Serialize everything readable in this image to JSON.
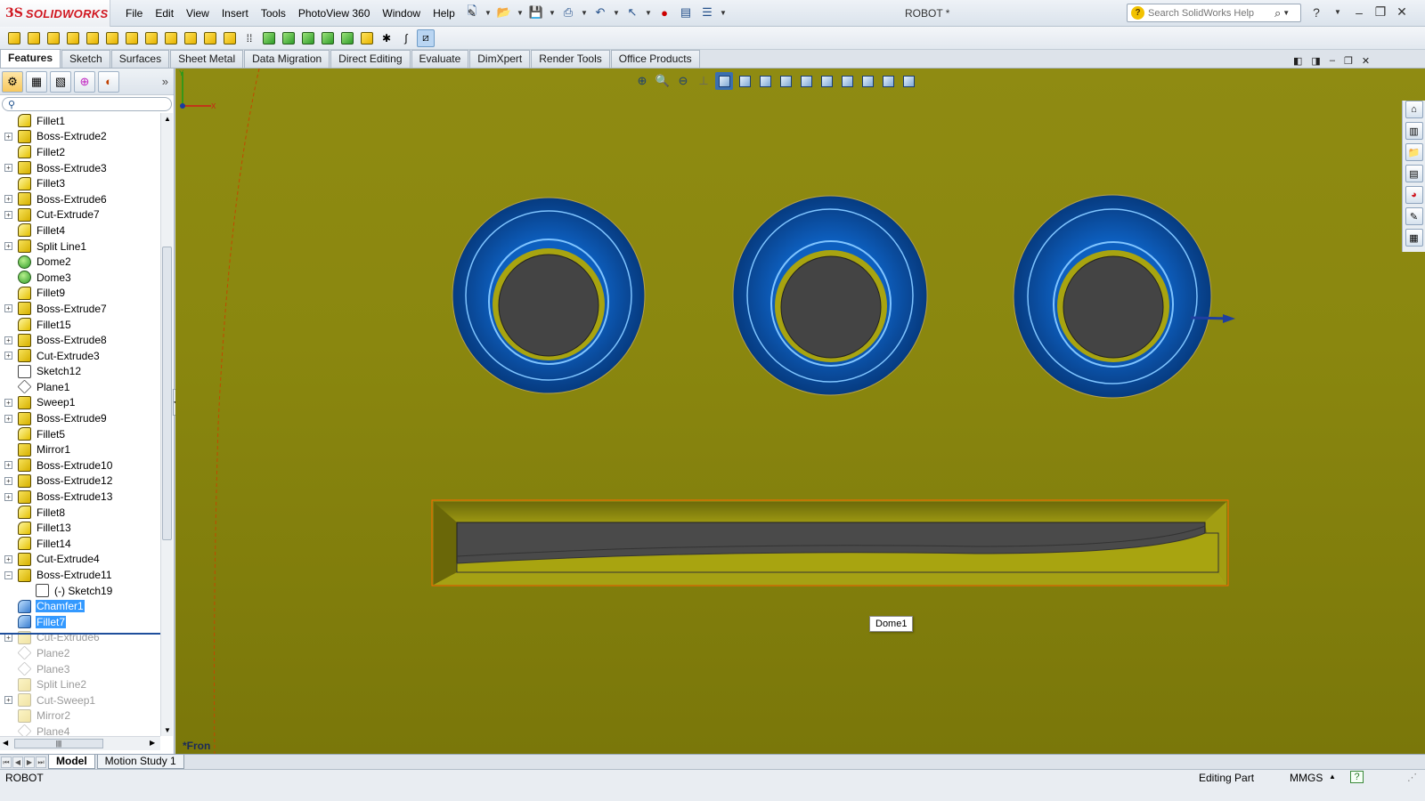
{
  "app": {
    "logo_mark": "3S",
    "logo_text": "SOLIDWORKS",
    "document_title": "ROBOT *"
  },
  "menu": [
    "File",
    "Edit",
    "View",
    "Insert",
    "Tools",
    "PhotoView 360",
    "Window",
    "Help"
  ],
  "search": {
    "placeholder": "Search SolidWorks Help"
  },
  "command_tabs": [
    "Features",
    "Sketch",
    "Surfaces",
    "Sheet Metal",
    "Data Migration",
    "Direct Editing",
    "Evaluate",
    "DimXpert",
    "Render Tools",
    "Office Products"
  ],
  "active_tab": "Features",
  "tree": [
    {
      "label": "Fillet1",
      "icon": "fillet",
      "expandable": false
    },
    {
      "label": "Boss-Extrude2",
      "icon": "extrude",
      "expandable": true
    },
    {
      "label": "Fillet2",
      "icon": "fillet",
      "expandable": false
    },
    {
      "label": "Boss-Extrude3",
      "icon": "extrude",
      "expandable": true
    },
    {
      "label": "Fillet3",
      "icon": "fillet",
      "expandable": false
    },
    {
      "label": "Boss-Extrude6",
      "icon": "extrude",
      "expandable": true
    },
    {
      "label": "Cut-Extrude7",
      "icon": "extrude",
      "expandable": true
    },
    {
      "label": "Fillet4",
      "icon": "fillet",
      "expandable": false
    },
    {
      "label": "Split Line1",
      "icon": "extrude",
      "expandable": true
    },
    {
      "label": "Dome2",
      "icon": "dome",
      "expandable": false
    },
    {
      "label": "Dome3",
      "icon": "dome",
      "expandable": false
    },
    {
      "label": "Fillet9",
      "icon": "fillet",
      "expandable": false
    },
    {
      "label": "Boss-Extrude7",
      "icon": "extrude",
      "expandable": true
    },
    {
      "label": "Fillet15",
      "icon": "fillet",
      "expandable": false
    },
    {
      "label": "Boss-Extrude8",
      "icon": "extrude",
      "expandable": true
    },
    {
      "label": "Cut-Extrude3",
      "icon": "extrude",
      "expandable": true
    },
    {
      "label": "Sketch12",
      "icon": "sketch",
      "expandable": false
    },
    {
      "label": "Plane1",
      "icon": "plane",
      "expandable": false
    },
    {
      "label": "Sweep1",
      "icon": "extrude",
      "expandable": true
    },
    {
      "label": "Boss-Extrude9",
      "icon": "extrude",
      "expandable": true
    },
    {
      "label": "Fillet5",
      "icon": "fillet",
      "expandable": false
    },
    {
      "label": "Mirror1",
      "icon": "extrude",
      "expandable": false
    },
    {
      "label": "Boss-Extrude10",
      "icon": "extrude",
      "expandable": true
    },
    {
      "label": "Boss-Extrude12",
      "icon": "extrude",
      "expandable": true
    },
    {
      "label": "Boss-Extrude13",
      "icon": "extrude",
      "expandable": true
    },
    {
      "label": "Fillet8",
      "icon": "fillet",
      "expandable": false
    },
    {
      "label": "Fillet13",
      "icon": "fillet",
      "expandable": false
    },
    {
      "label": "Fillet14",
      "icon": "fillet",
      "expandable": false
    },
    {
      "label": "Cut-Extrude4",
      "icon": "extrude",
      "expandable": true
    },
    {
      "label": "Boss-Extrude11",
      "icon": "extrude",
      "expandable": true,
      "expanded": true
    },
    {
      "label": "(-) Sketch19",
      "icon": "sketch",
      "expandable": false,
      "child": true
    },
    {
      "label": "Chamfer1",
      "icon": "blue",
      "expandable": false,
      "selected": true
    },
    {
      "label": "Fillet7",
      "icon": "blue",
      "expandable": false,
      "selected": true
    },
    {
      "label": "Cut-Extrude6",
      "icon": "extrude",
      "expandable": true,
      "suppressed": true
    },
    {
      "label": "Plane2",
      "icon": "plane",
      "expandable": false,
      "suppressed": true
    },
    {
      "label": "Plane3",
      "icon": "plane",
      "expandable": false,
      "suppressed": true
    },
    {
      "label": "Split Line2",
      "icon": "extrude",
      "expandable": false,
      "suppressed": true
    },
    {
      "label": "Cut-Sweep1",
      "icon": "extrude",
      "expandable": true,
      "suppressed": true
    },
    {
      "label": "Mirror2",
      "icon": "extrude",
      "expandable": false,
      "suppressed": true
    },
    {
      "label": "Plane4",
      "icon": "plane",
      "expandable": false,
      "suppressed": true
    }
  ],
  "viewport": {
    "tooltip": "Dome1",
    "view_name": "*Fron",
    "model_color": "#8e8b12",
    "feature_color": "#0a4a9a"
  },
  "bottom_tabs": [
    "Model",
    "Motion Study 1"
  ],
  "status": {
    "left": "ROBOT",
    "mode": "Editing Part",
    "units": "MMGS"
  }
}
